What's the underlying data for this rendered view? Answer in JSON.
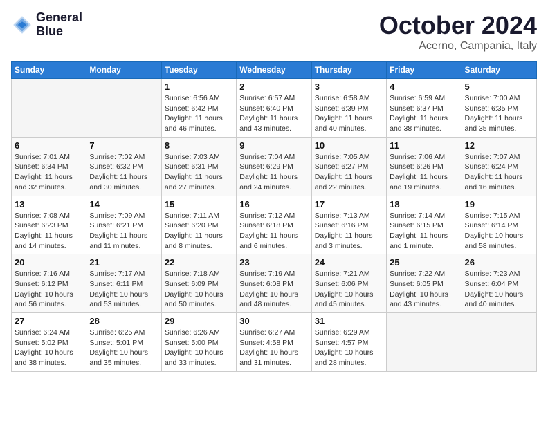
{
  "header": {
    "logo_line1": "General",
    "logo_line2": "Blue",
    "month_title": "October 2024",
    "location": "Acerno, Campania, Italy"
  },
  "weekdays": [
    "Sunday",
    "Monday",
    "Tuesday",
    "Wednesday",
    "Thursday",
    "Friday",
    "Saturday"
  ],
  "weeks": [
    [
      {
        "day": "",
        "sunrise": "",
        "sunset": "",
        "daylight": ""
      },
      {
        "day": "",
        "sunrise": "",
        "sunset": "",
        "daylight": ""
      },
      {
        "day": "1",
        "sunrise": "Sunrise: 6:56 AM",
        "sunset": "Sunset: 6:42 PM",
        "daylight": "Daylight: 11 hours and 46 minutes."
      },
      {
        "day": "2",
        "sunrise": "Sunrise: 6:57 AM",
        "sunset": "Sunset: 6:40 PM",
        "daylight": "Daylight: 11 hours and 43 minutes."
      },
      {
        "day": "3",
        "sunrise": "Sunrise: 6:58 AM",
        "sunset": "Sunset: 6:39 PM",
        "daylight": "Daylight: 11 hours and 40 minutes."
      },
      {
        "day": "4",
        "sunrise": "Sunrise: 6:59 AM",
        "sunset": "Sunset: 6:37 PM",
        "daylight": "Daylight: 11 hours and 38 minutes."
      },
      {
        "day": "5",
        "sunrise": "Sunrise: 7:00 AM",
        "sunset": "Sunset: 6:35 PM",
        "daylight": "Daylight: 11 hours and 35 minutes."
      }
    ],
    [
      {
        "day": "6",
        "sunrise": "Sunrise: 7:01 AM",
        "sunset": "Sunset: 6:34 PM",
        "daylight": "Daylight: 11 hours and 32 minutes."
      },
      {
        "day": "7",
        "sunrise": "Sunrise: 7:02 AM",
        "sunset": "Sunset: 6:32 PM",
        "daylight": "Daylight: 11 hours and 30 minutes."
      },
      {
        "day": "8",
        "sunrise": "Sunrise: 7:03 AM",
        "sunset": "Sunset: 6:31 PM",
        "daylight": "Daylight: 11 hours and 27 minutes."
      },
      {
        "day": "9",
        "sunrise": "Sunrise: 7:04 AM",
        "sunset": "Sunset: 6:29 PM",
        "daylight": "Daylight: 11 hours and 24 minutes."
      },
      {
        "day": "10",
        "sunrise": "Sunrise: 7:05 AM",
        "sunset": "Sunset: 6:27 PM",
        "daylight": "Daylight: 11 hours and 22 minutes."
      },
      {
        "day": "11",
        "sunrise": "Sunrise: 7:06 AM",
        "sunset": "Sunset: 6:26 PM",
        "daylight": "Daylight: 11 hours and 19 minutes."
      },
      {
        "day": "12",
        "sunrise": "Sunrise: 7:07 AM",
        "sunset": "Sunset: 6:24 PM",
        "daylight": "Daylight: 11 hours and 16 minutes."
      }
    ],
    [
      {
        "day": "13",
        "sunrise": "Sunrise: 7:08 AM",
        "sunset": "Sunset: 6:23 PM",
        "daylight": "Daylight: 11 hours and 14 minutes."
      },
      {
        "day": "14",
        "sunrise": "Sunrise: 7:09 AM",
        "sunset": "Sunset: 6:21 PM",
        "daylight": "Daylight: 11 hours and 11 minutes."
      },
      {
        "day": "15",
        "sunrise": "Sunrise: 7:11 AM",
        "sunset": "Sunset: 6:20 PM",
        "daylight": "Daylight: 11 hours and 8 minutes."
      },
      {
        "day": "16",
        "sunrise": "Sunrise: 7:12 AM",
        "sunset": "Sunset: 6:18 PM",
        "daylight": "Daylight: 11 hours and 6 minutes."
      },
      {
        "day": "17",
        "sunrise": "Sunrise: 7:13 AM",
        "sunset": "Sunset: 6:16 PM",
        "daylight": "Daylight: 11 hours and 3 minutes."
      },
      {
        "day": "18",
        "sunrise": "Sunrise: 7:14 AM",
        "sunset": "Sunset: 6:15 PM",
        "daylight": "Daylight: 11 hours and 1 minute."
      },
      {
        "day": "19",
        "sunrise": "Sunrise: 7:15 AM",
        "sunset": "Sunset: 6:14 PM",
        "daylight": "Daylight: 10 hours and 58 minutes."
      }
    ],
    [
      {
        "day": "20",
        "sunrise": "Sunrise: 7:16 AM",
        "sunset": "Sunset: 6:12 PM",
        "daylight": "Daylight: 10 hours and 56 minutes."
      },
      {
        "day": "21",
        "sunrise": "Sunrise: 7:17 AM",
        "sunset": "Sunset: 6:11 PM",
        "daylight": "Daylight: 10 hours and 53 minutes."
      },
      {
        "day": "22",
        "sunrise": "Sunrise: 7:18 AM",
        "sunset": "Sunset: 6:09 PM",
        "daylight": "Daylight: 10 hours and 50 minutes."
      },
      {
        "day": "23",
        "sunrise": "Sunrise: 7:19 AM",
        "sunset": "Sunset: 6:08 PM",
        "daylight": "Daylight: 10 hours and 48 minutes."
      },
      {
        "day": "24",
        "sunrise": "Sunrise: 7:21 AM",
        "sunset": "Sunset: 6:06 PM",
        "daylight": "Daylight: 10 hours and 45 minutes."
      },
      {
        "day": "25",
        "sunrise": "Sunrise: 7:22 AM",
        "sunset": "Sunset: 6:05 PM",
        "daylight": "Daylight: 10 hours and 43 minutes."
      },
      {
        "day": "26",
        "sunrise": "Sunrise: 7:23 AM",
        "sunset": "Sunset: 6:04 PM",
        "daylight": "Daylight: 10 hours and 40 minutes."
      }
    ],
    [
      {
        "day": "27",
        "sunrise": "Sunrise: 6:24 AM",
        "sunset": "Sunset: 5:02 PM",
        "daylight": "Daylight: 10 hours and 38 minutes."
      },
      {
        "day": "28",
        "sunrise": "Sunrise: 6:25 AM",
        "sunset": "Sunset: 5:01 PM",
        "daylight": "Daylight: 10 hours and 35 minutes."
      },
      {
        "day": "29",
        "sunrise": "Sunrise: 6:26 AM",
        "sunset": "Sunset: 5:00 PM",
        "daylight": "Daylight: 10 hours and 33 minutes."
      },
      {
        "day": "30",
        "sunrise": "Sunrise: 6:27 AM",
        "sunset": "Sunset: 4:58 PM",
        "daylight": "Daylight: 10 hours and 31 minutes."
      },
      {
        "day": "31",
        "sunrise": "Sunrise: 6:29 AM",
        "sunset": "Sunset: 4:57 PM",
        "daylight": "Daylight: 10 hours and 28 minutes."
      },
      {
        "day": "",
        "sunrise": "",
        "sunset": "",
        "daylight": ""
      },
      {
        "day": "",
        "sunrise": "",
        "sunset": "",
        "daylight": ""
      }
    ]
  ]
}
